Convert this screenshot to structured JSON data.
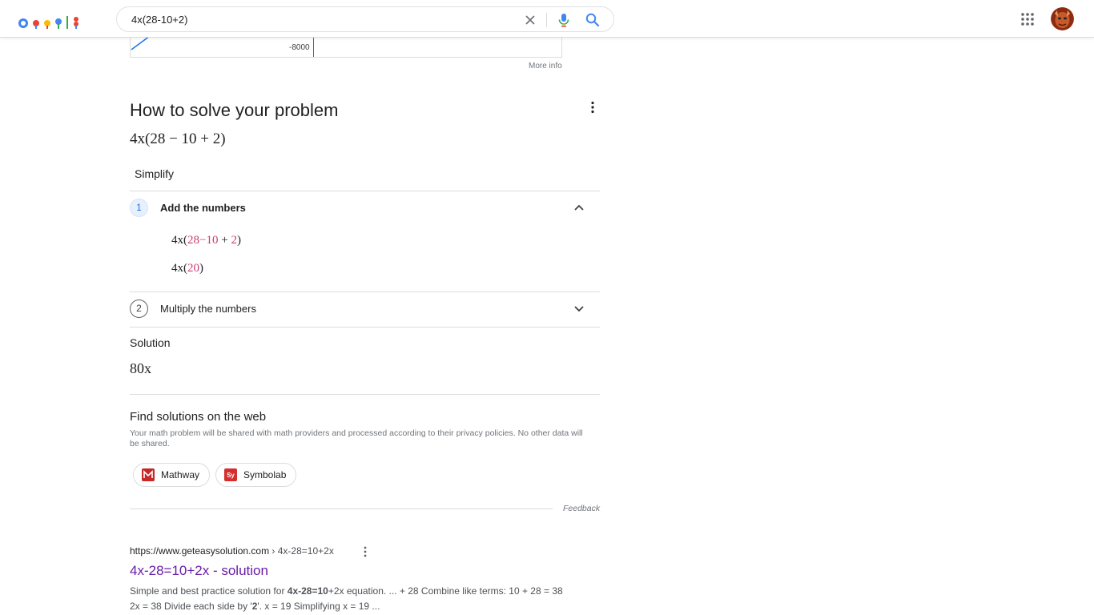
{
  "header": {
    "search_query": "4x(28-10+2)",
    "logo_icon": "google-doodle-icon",
    "clear_icon": "close-icon",
    "voice_icon": "mic-icon",
    "search_icon": "search-icon",
    "apps_icon": "apps-grid-icon",
    "avatar_icon": "avatar-icon"
  },
  "graph": {
    "tick_label": "-8000",
    "more_info": "More info"
  },
  "solver": {
    "heading": "How to solve your problem",
    "expression": "4x(28 − 10 + 2)",
    "method": "Simplify",
    "steps": [
      {
        "number": "1",
        "title": "Add the numbers",
        "expanded": true,
        "lines": [
          {
            "prefix": "4x(",
            "highlight": "28−10",
            "middle": " + ",
            "highlight2": "2",
            "suffix": ")"
          },
          {
            "prefix": "4x(",
            "highlight": "20",
            "suffix": ")"
          }
        ]
      },
      {
        "number": "2",
        "title": "Multiply the numbers",
        "expanded": false
      }
    ],
    "solution_label": "Solution",
    "solution": "80x"
  },
  "web": {
    "heading": "Find solutions on the web",
    "privacy": "Your math problem will be shared with math providers and processed according to their privacy policies. No other data will be shared.",
    "providers": [
      {
        "name": "Mathway",
        "logo_color": "#c62828"
      },
      {
        "name": "Symbolab",
        "logo_text": "Sy",
        "logo_color": "#d32f2f"
      }
    ],
    "feedback": "Feedback"
  },
  "result": {
    "site": "https://www.geteasysolution.com",
    "crumb": " › 4x-28=10+2x",
    "title": "4x-28=10+2x - solution",
    "snippet_a": "Simple and best practice solution for ",
    "snippet_b": "4x-28=10",
    "snippet_c": "+2x equation. ... + 28 Combine like terms: 10 + 28 = 38 2x = 38 Divide each side by '",
    "snippet_d": "2",
    "snippet_e": "'. x = 19 Simplifying x = 19 ..."
  },
  "colors": {
    "link_visited": "#681da8",
    "accent_blue": "#1a73e8",
    "highlight_pink": "#c2185b"
  }
}
